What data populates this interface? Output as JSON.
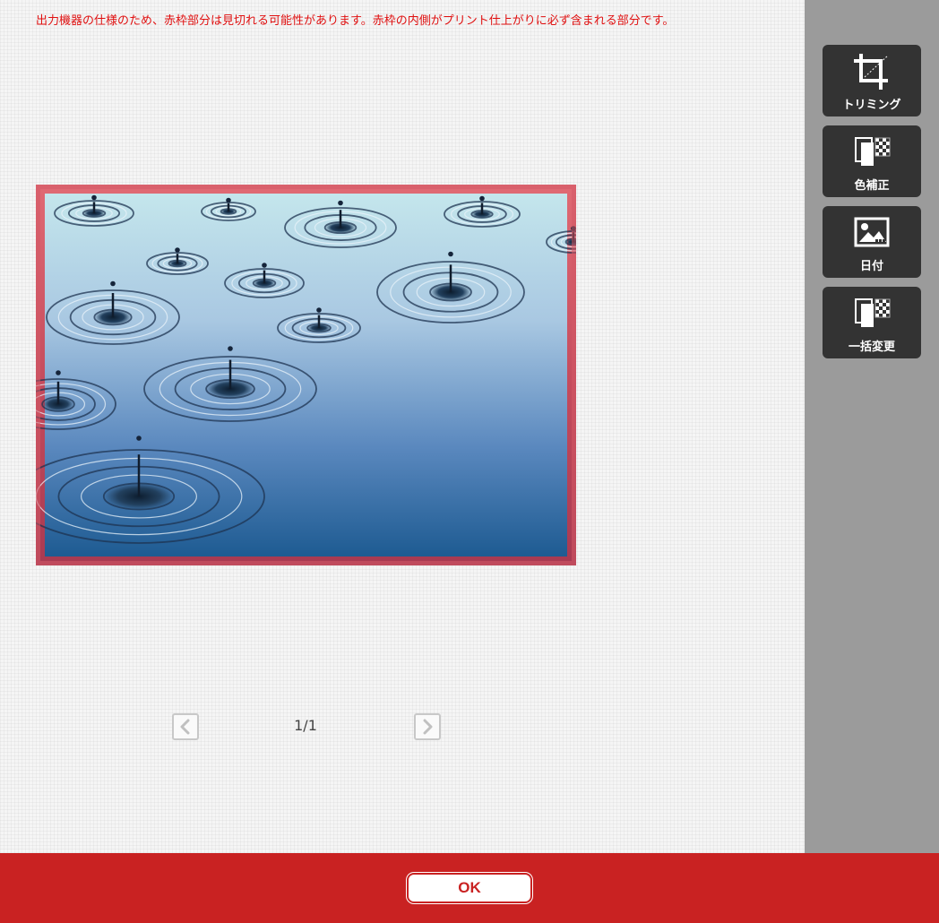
{
  "notice": {
    "text": "出力機器の仕様のため、赤枠部分は見切れる可能性があります。赤枠の内側がプリント仕上がりに必ず含まれる部分です。",
    "color": "#e01010"
  },
  "photo": {
    "subject": "water droplets ripples",
    "frame_color": "#d85a68"
  },
  "pager": {
    "indicator": "1/1",
    "prev_icon": "chevron-left-icon",
    "next_icon": "chevron-right-icon"
  },
  "tools": [
    {
      "label": "トリミング",
      "icon": "crop-icon"
    },
    {
      "label": "色補正",
      "icon": "color-correction-icon"
    },
    {
      "label": "日付",
      "icon": "date-image-icon"
    },
    {
      "label": "一括変更",
      "icon": "batch-change-icon"
    }
  ],
  "footer": {
    "ok_label": "OK",
    "color": "#c92222"
  }
}
